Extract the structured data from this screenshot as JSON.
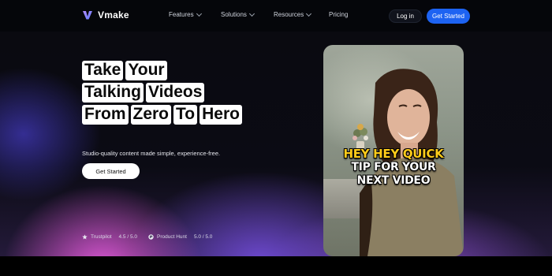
{
  "header": {
    "brand": "Vmake",
    "nav": [
      {
        "label": "Features",
        "has_dropdown": true
      },
      {
        "label": "Solutions",
        "has_dropdown": true
      },
      {
        "label": "Resources",
        "has_dropdown": true
      },
      {
        "label": "Pricing",
        "has_dropdown": false
      }
    ],
    "login_label": "Log in",
    "get_started_label": "Get Started"
  },
  "hero": {
    "headline_rows": [
      [
        "Take",
        "Your"
      ],
      [
        "Talking",
        "Videos"
      ],
      [
        "From",
        "Zero",
        "To",
        "Hero"
      ]
    ],
    "subtitle": "Studio-quality content made simple, experience-free.",
    "cta_label": "Get Started",
    "ratings": [
      {
        "source": "Trustpilot",
        "score": "4.5 / 5.0",
        "icon": "star-icon"
      },
      {
        "source": "Product Hunt",
        "score": "5.0 / 5.0",
        "icon": "product-hunt-icon"
      }
    ]
  },
  "video": {
    "caption_lines": [
      "HEY HEY QUICK",
      "TIP FOR YOUR",
      "NEXT VIDEO"
    ]
  },
  "colors": {
    "accent_blue": "#1d63f2",
    "caption_yellow": "#ffcc1a",
    "glow_pink": "#e65adc",
    "glow_purple": "#7850e6"
  }
}
